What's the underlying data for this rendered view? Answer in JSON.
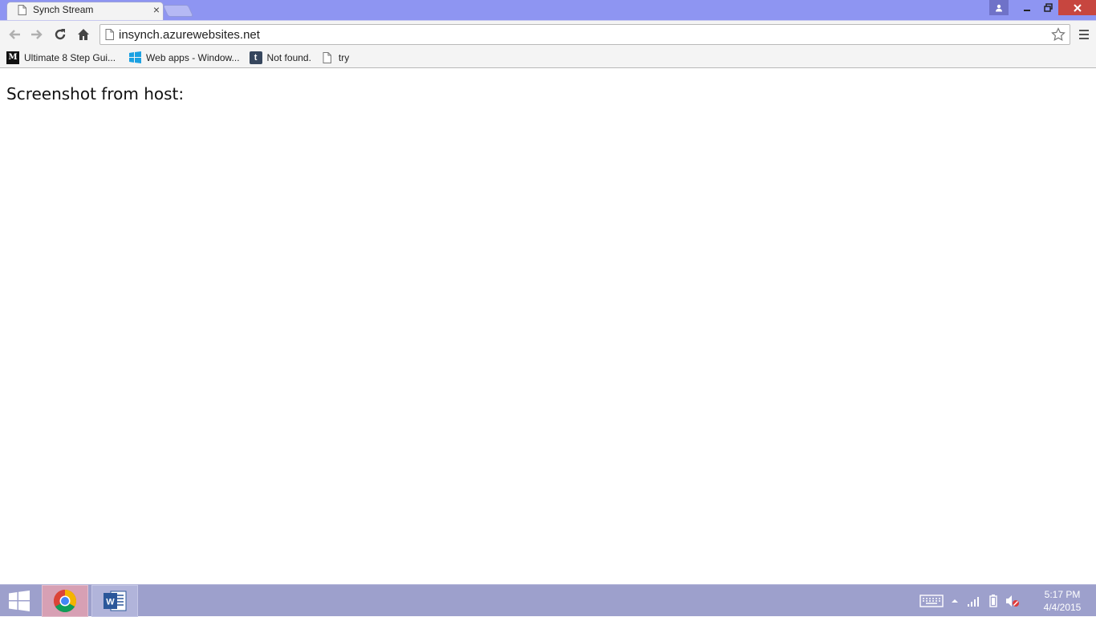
{
  "browser": {
    "tab_title": "Synch Stream",
    "tab_close": "×",
    "url": "insynch.azurewebsites.net"
  },
  "bookmarks": [
    {
      "label": "Ultimate 8 Step Gui...",
      "icon": "medium-m-icon"
    },
    {
      "label": "Web apps - Window...",
      "icon": "windows-logo-icon"
    },
    {
      "label": "Not found.",
      "icon": "tumblr-t-icon"
    },
    {
      "label": "try",
      "icon": "page-icon"
    }
  ],
  "page": {
    "heading": "Screenshot from host:"
  },
  "taskbar": {
    "apps": [
      {
        "name": "Google Chrome",
        "icon": "chrome-icon",
        "active": true
      },
      {
        "name": "Microsoft Word",
        "icon": "word-icon",
        "active": false
      }
    ],
    "clock_time": "5:17 PM",
    "clock_date": "4/4/2015"
  },
  "colors": {
    "titlebar": "#8e95f2",
    "taskbar": "#9da0cc",
    "close_button": "#c7463f"
  }
}
